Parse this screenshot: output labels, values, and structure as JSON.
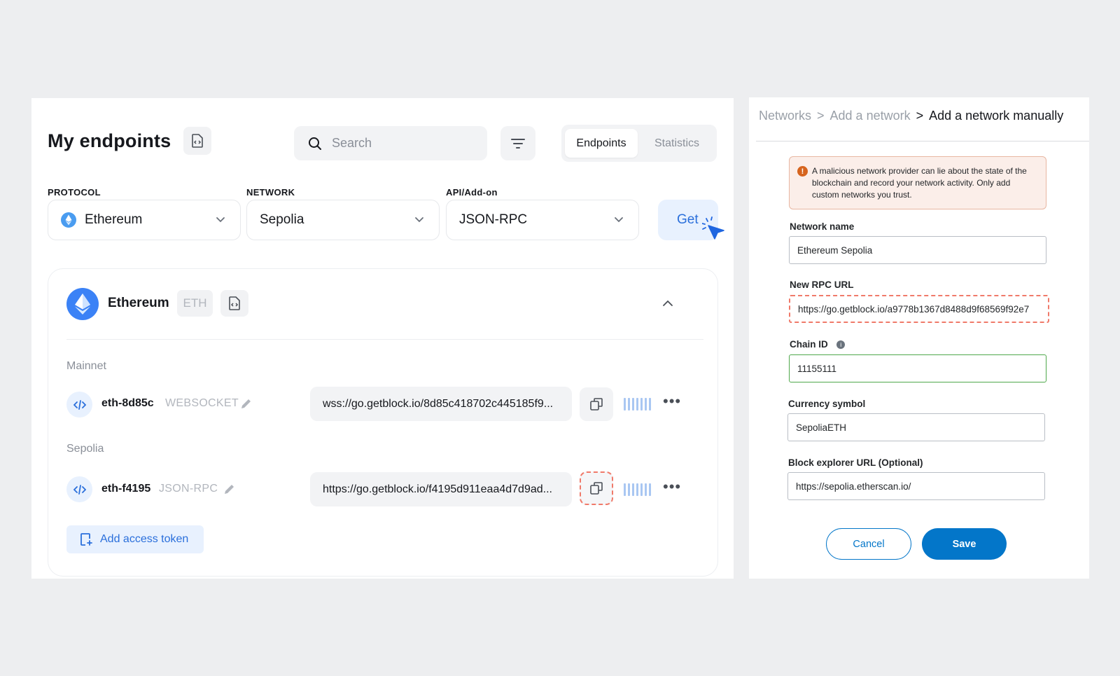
{
  "endpoints_panel": {
    "title": "My endpoints",
    "search": {
      "placeholder": "Search"
    },
    "tabs": [
      {
        "label": "Endpoints",
        "active": true
      },
      {
        "label": "Statistics",
        "active": false
      }
    ],
    "selectors": [
      {
        "label": "PROTOCOL",
        "value": "Ethereum"
      },
      {
        "label": "NETWORK",
        "value": "Sepolia"
      },
      {
        "label": "API/Add-on",
        "value": "JSON-RPC"
      }
    ],
    "get_button": "Get",
    "protocol_card": {
      "name": "Ethereum",
      "ticker": "ETH",
      "groups": [
        {
          "label": "Mainnet",
          "endpoint": {
            "name": "eth-8d85c",
            "type": "WEBSOCKET",
            "url": "wss://go.getblock.io/8d85c418702c445185f9..."
          }
        },
        {
          "label": "Sepolia",
          "endpoint": {
            "name": "eth-f4195",
            "type": "JSON-RPC",
            "url": "https://go.getblock.io/f4195d911eaa4d7d9ad..."
          }
        }
      ],
      "add_token_label": "Add access token"
    }
  },
  "network_form": {
    "breadcrumb": [
      "Networks",
      "Add a network",
      "Add a network manually"
    ],
    "breadcrumb_separator": ">",
    "warning": "A malicious network provider can lie about the state of the blockchain and record your network activity. Only add custom networks you trust.",
    "fields": [
      {
        "label": "Network name",
        "value": "Ethereum Sepolia"
      },
      {
        "label": "New RPC URL",
        "value": "https://go.getblock.io/a9778b1367d8488d9f68569f92e7"
      },
      {
        "label": "Chain ID",
        "value": "11155111"
      },
      {
        "label": "Currency symbol",
        "value": "SepoliaETH"
      },
      {
        "label": "Block explorer URL (Optional)",
        "value": "https://sepolia.etherscan.io/"
      }
    ],
    "cancel_label": "Cancel",
    "save_label": "Save"
  },
  "colors": {
    "accent_blue": "#2a6fdb",
    "save_blue": "#0376c9",
    "highlight_dashed": "#f07a6a",
    "valid_green": "#4fa84b",
    "warning_bg": "#fbeee9"
  }
}
